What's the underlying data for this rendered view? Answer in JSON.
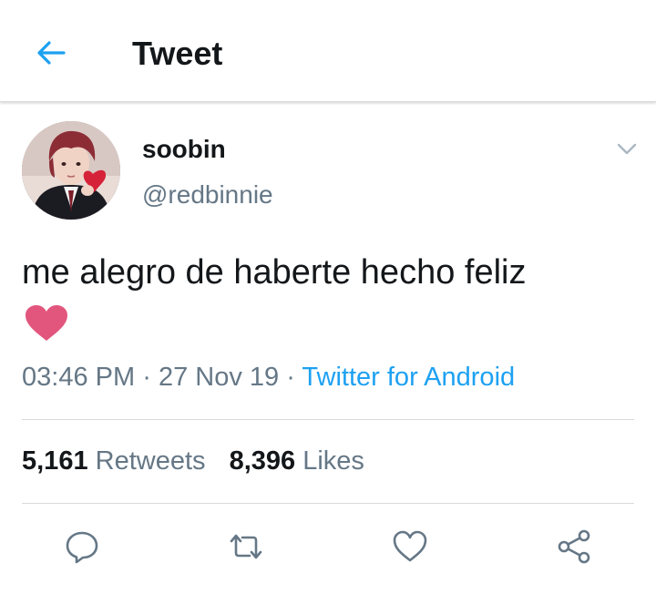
{
  "header": {
    "title": "Tweet",
    "back_icon": "arrow-left-icon",
    "accent": "#1da1f2"
  },
  "tweet": {
    "display_name": "soobin",
    "handle": "@redbinnie",
    "text": "me alegro de haberte hecho feliz",
    "emoji": "pink-heart",
    "time": "03:46 PM",
    "date": "27 Nov 19",
    "separator": "·",
    "source": "Twitter for Android"
  },
  "stats": {
    "retweets_count": "5,161",
    "retweets_label": "Retweets",
    "likes_count": "8,396",
    "likes_label": "Likes"
  },
  "actions": [
    "reply-icon",
    "retweet-icon",
    "like-icon",
    "share-icon"
  ],
  "colors": {
    "text": "#14171a",
    "secondary": "#657786",
    "link": "#1da1f2",
    "heart": "#e2567e",
    "divider": "#d7dbde"
  }
}
